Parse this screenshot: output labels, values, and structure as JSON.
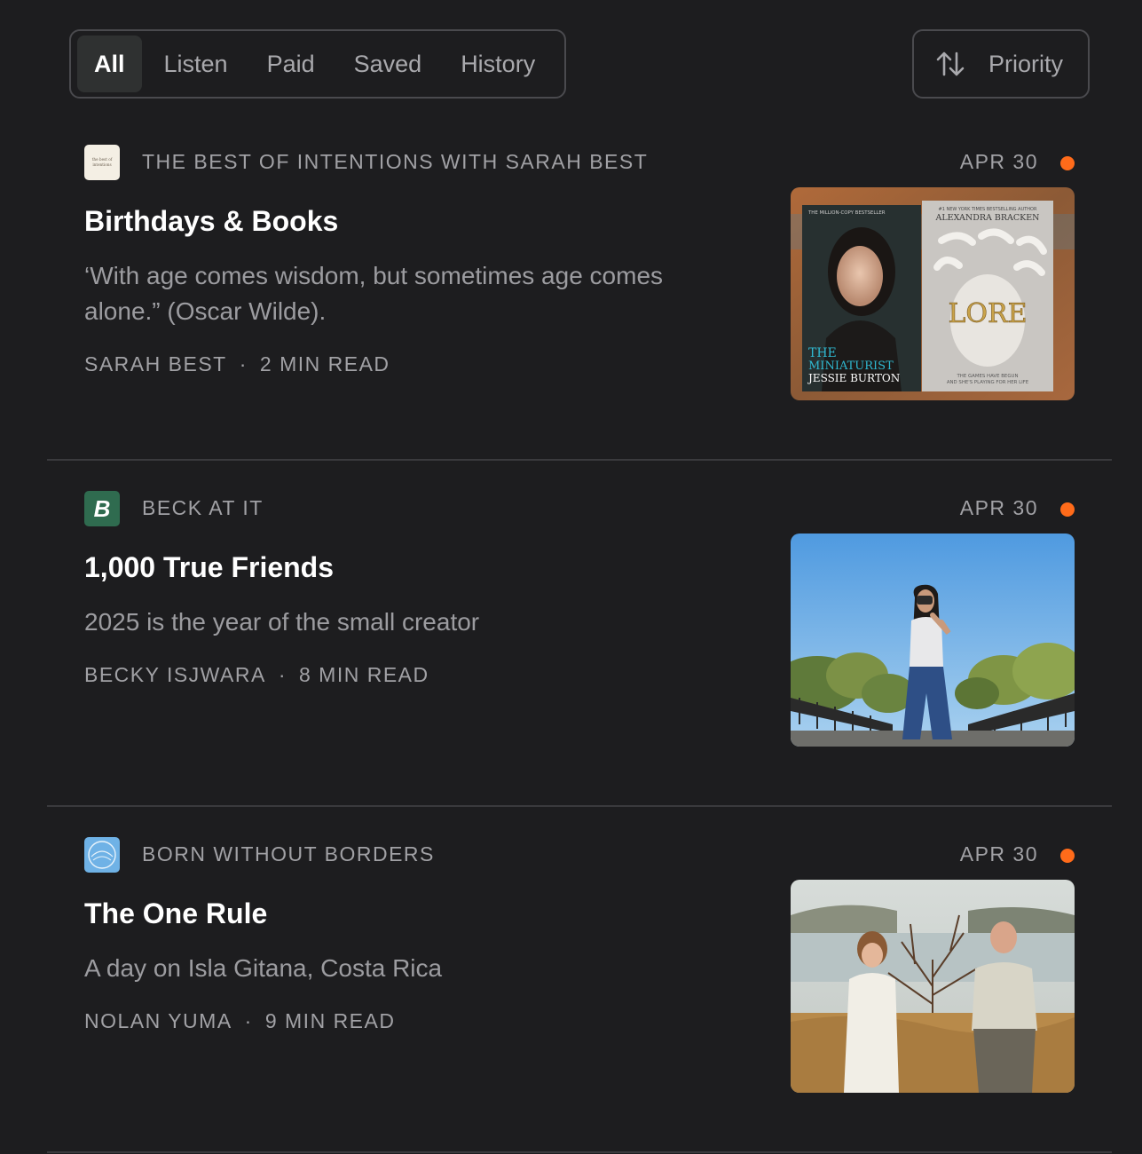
{
  "filters": {
    "tabs": [
      {
        "label": "All"
      },
      {
        "label": "Listen"
      },
      {
        "label": "Paid"
      },
      {
        "label": "Saved"
      },
      {
        "label": "History"
      }
    ],
    "active": "All"
  },
  "sort": {
    "label": "Priority",
    "icon": "sort-arrows-icon"
  },
  "accent_color": "#ff6b1a",
  "posts": [
    {
      "publication": "THE BEST OF INTENTIONS WITH SARAH BEST",
      "logo_text": "the best of intentions",
      "date": "APR 30",
      "title": "Birthdays & Books",
      "subtitle": "‘With age comes wisdom, but sometimes age comes alone.” (Oscar Wilde).",
      "author": "SARAH BEST",
      "read_time": "2 MIN READ",
      "thumbnail": {
        "book1_top": "THE MILLION-COPY BESTSELLER",
        "book1_title_a": "THE",
        "book1_title_b": "MINIATURIST",
        "book1_author": "JESSIE BURTON",
        "book2_top": "#1 NEW YORK TIMES BESTSELLING AUTHOR",
        "book2_author": "ALEXANDRA BRACKEN",
        "book2_title": "LORE",
        "book2_tagline_a": "THE GAMES HAVE BEGUN",
        "book2_tagline_b": "AND SHE'S PLAYING FOR HER LIFE"
      }
    },
    {
      "publication": "BECK AT IT",
      "logo_text": "B",
      "date": "APR 30",
      "title": "1,000 True Friends",
      "subtitle": "2025 is the year of the small creator",
      "author": "BECKY ISJWARA",
      "read_time": "8 MIN READ"
    },
    {
      "publication": "BORN WITHOUT BORDERS",
      "date": "APR 30",
      "title": "The One Rule",
      "subtitle": "A day on Isla Gitana, Costa Rica",
      "author": "NOLAN YUMA",
      "read_time": "9 MIN READ"
    }
  ]
}
